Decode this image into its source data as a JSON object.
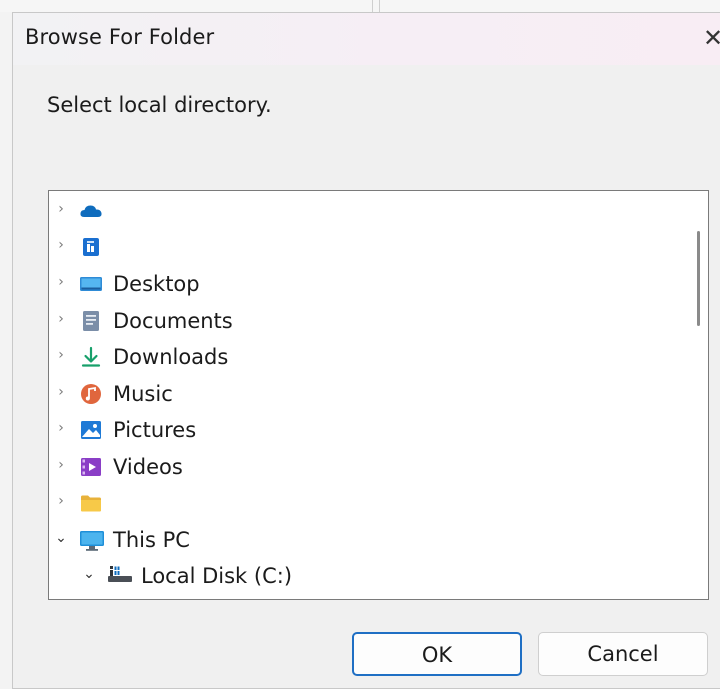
{
  "dialog": {
    "title": "Browse For Folder",
    "close_glyph": "✕",
    "prompt": "Select local directory."
  },
  "tree": {
    "items": [
      {
        "label": "",
        "icon": "cloud-icon",
        "expanded": false
      },
      {
        "label": "",
        "icon": "home-icon",
        "expanded": false
      },
      {
        "label": "Desktop",
        "icon": "desktop-icon",
        "expanded": false
      },
      {
        "label": "Documents",
        "icon": "documents-icon",
        "expanded": false
      },
      {
        "label": "Downloads",
        "icon": "download-icon",
        "expanded": false
      },
      {
        "label": "Music",
        "icon": "music-icon",
        "expanded": false
      },
      {
        "label": "Pictures",
        "icon": "pictures-icon",
        "expanded": false
      },
      {
        "label": "Videos",
        "icon": "videos-icon",
        "expanded": false
      },
      {
        "label": "",
        "icon": "folder-icon",
        "expanded": false
      },
      {
        "label": "This PC",
        "icon": "computer-icon",
        "expanded": true
      },
      {
        "label": "Local Disk (C:)",
        "icon": "drive-icon",
        "expanded": true
      }
    ],
    "chevron_collapsed": "›",
    "chevron_expanded": "⌄"
  },
  "buttons": {
    "ok": "OK",
    "cancel": "Cancel"
  },
  "colors": {
    "accent": "#1f6fc4",
    "onedrive": "#0f6cbd",
    "folder": "#f7c948",
    "music": "#e0663d",
    "videos": "#8a3ec6",
    "download": "#18a06b"
  }
}
